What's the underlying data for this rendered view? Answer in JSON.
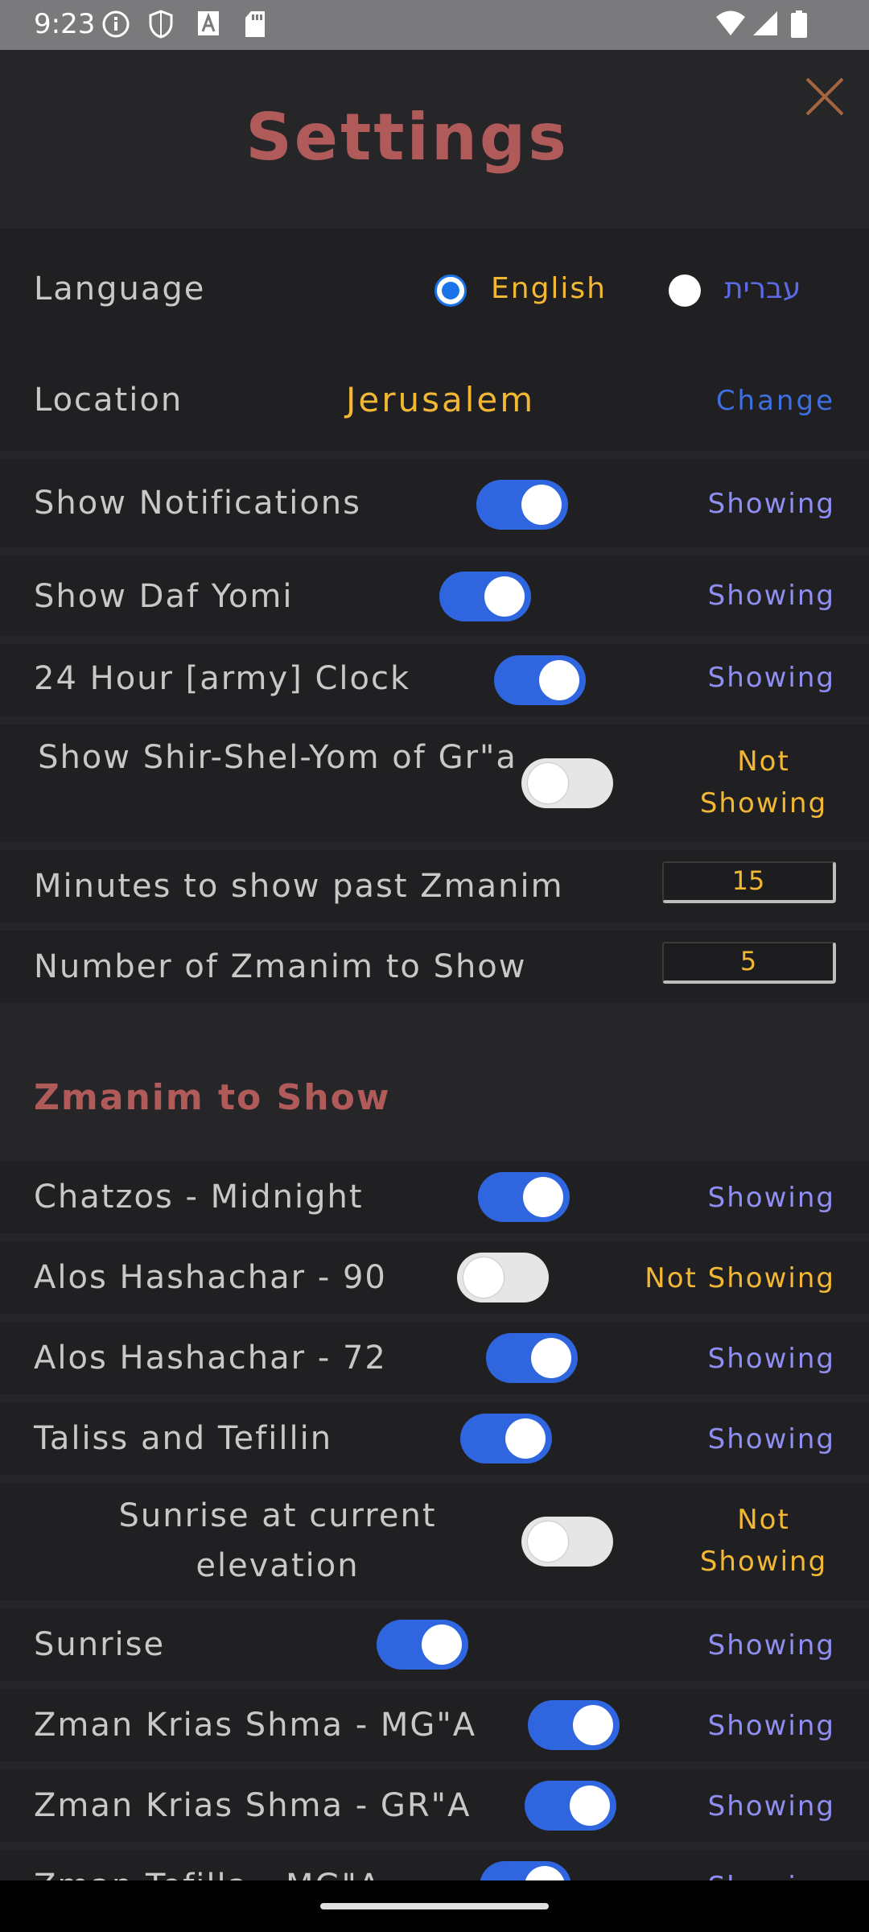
{
  "status_bar": {
    "time": "9:23",
    "left_icons": [
      "info-icon",
      "shield-icon",
      "font-icon",
      "sd-card-icon"
    ],
    "right_icons": [
      "wifi-icon",
      "signal-icon",
      "battery-icon"
    ]
  },
  "page": {
    "title": "Settings",
    "close_icon": "close-icon"
  },
  "language": {
    "label": "Language",
    "options": [
      "English",
      "עברית"
    ],
    "selected": "English"
  },
  "location": {
    "label": "Location",
    "value": "Jerusalem",
    "change_label": "Change"
  },
  "general_settings": [
    {
      "label": "Show Notifications",
      "on": true,
      "status": "Showing"
    },
    {
      "label": "Show Daf Yomi",
      "on": true,
      "status": "Showing"
    },
    {
      "label": "24 Hour [army] Clock",
      "on": true,
      "status": "Showing"
    },
    {
      "label": "Show Shir-Shel-Yom of Gr\"a",
      "on": false,
      "status": "Not Showing"
    }
  ],
  "numeric_settings": [
    {
      "label": "Minutes to show past Zmanim",
      "value": "15"
    },
    {
      "label": "Number of Zmanim to Show",
      "value": "5"
    }
  ],
  "zmanim_section": {
    "title": "Zmanim to Show",
    "items": [
      {
        "label": "Chatzos - Midnight",
        "on": true,
        "status": "Showing"
      },
      {
        "label": "Alos Hashachar - 90",
        "on": false,
        "status": "Not Showing"
      },
      {
        "label": "Alos Hashachar - 72",
        "on": true,
        "status": "Showing"
      },
      {
        "label": "Taliss and Tefillin",
        "on": true,
        "status": "Showing"
      },
      {
        "label": "Sunrise at current elevation",
        "on": false,
        "status": "Not Showing"
      },
      {
        "label": "Sunrise",
        "on": true,
        "status": "Showing"
      },
      {
        "label": "Zman Krias Shma - MG\"A",
        "on": true,
        "status": "Showing"
      },
      {
        "label": "Zman Krias Shma - GR\"A",
        "on": true,
        "status": "Showing"
      },
      {
        "label": "Zman Tefilla - MG\"A",
        "on": true,
        "status": "Showing"
      }
    ]
  },
  "colors": {
    "background": "#262629",
    "row_background": "#202023",
    "title": "#b05a5a",
    "accent_yellow": "#f2b733",
    "showing_text": "#8f8ff2",
    "toggle_on": "#2f66e0",
    "link_blue": "#3e6fe0"
  }
}
